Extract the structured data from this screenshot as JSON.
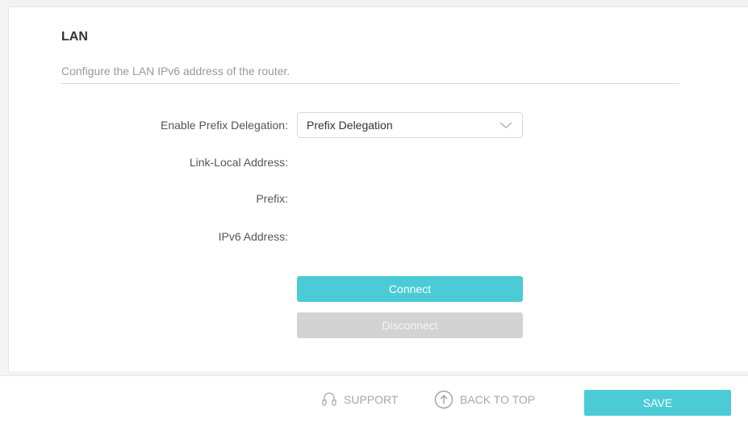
{
  "section": {
    "title": "LAN",
    "description": "Configure the LAN IPv6 address of the router."
  },
  "form": {
    "prefix_delegation": {
      "label": "Enable Prefix Delegation:",
      "value": "Prefix Delegation"
    },
    "link_local": {
      "label": "Link-Local Address:",
      "value": ""
    },
    "prefix": {
      "label": "Prefix:",
      "value": ""
    },
    "ipv6_address": {
      "label": "IPv6 Address:",
      "value": ""
    }
  },
  "buttons": {
    "connect": "Connect",
    "disconnect": "Disconnect"
  },
  "footer": {
    "support": "SUPPORT",
    "back_to_top": "BACK TO TOP",
    "save": "SAVE"
  },
  "icons": {
    "dropdown": "chevron-down-icon",
    "support": "headset-icon",
    "back_to_top": "arrow-up-circle-icon"
  },
  "colors": {
    "accent": "#4acbd6",
    "disabled": "#d3d3d3",
    "muted_text": "#a7a7a7"
  }
}
